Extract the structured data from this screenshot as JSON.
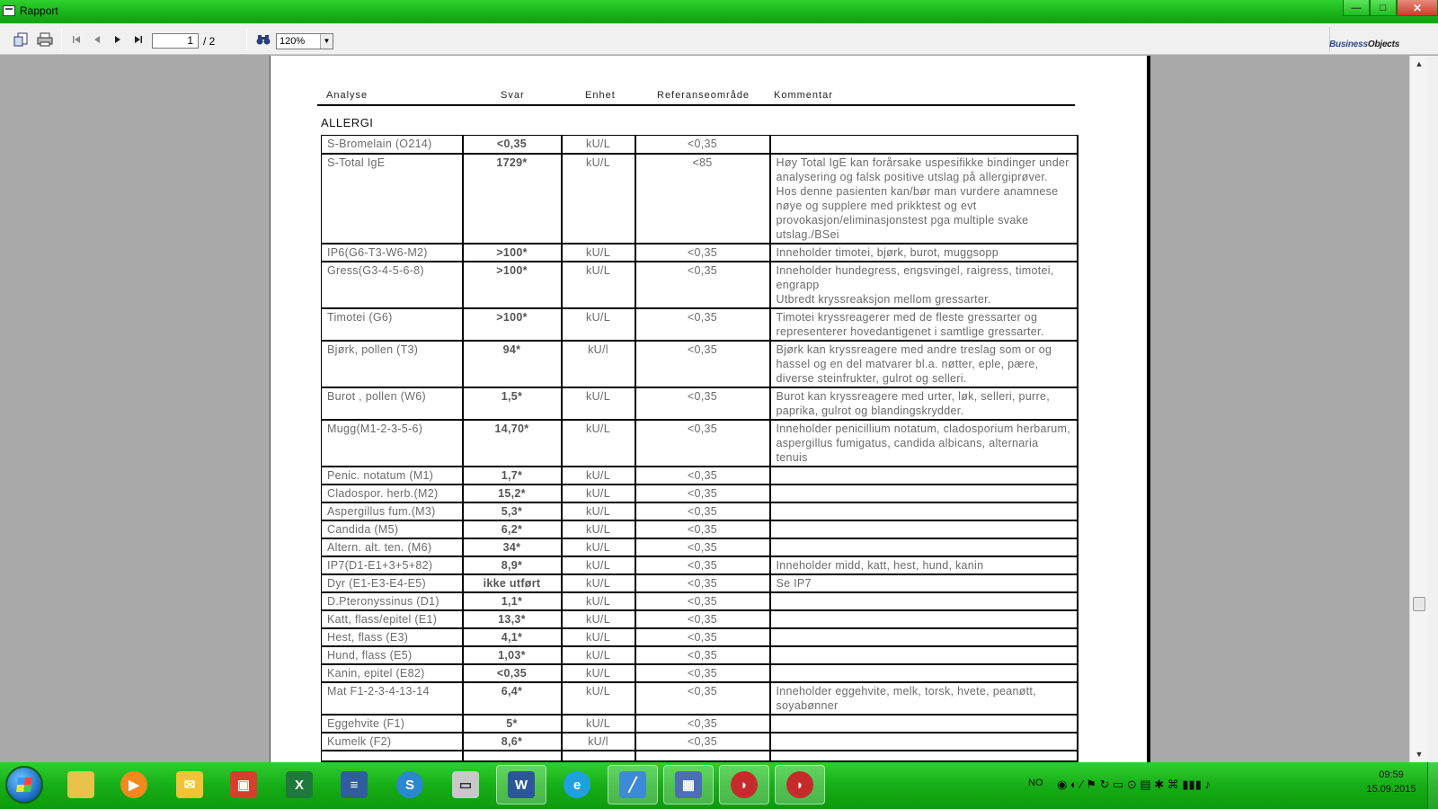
{
  "window": {
    "title": "Rapport",
    "minimize": "—",
    "maximize": "□",
    "close": "✕"
  },
  "toolbar": {
    "page_current": "1",
    "page_total": "/ 2",
    "zoom": "120%",
    "brand_a": "Business",
    "brand_b": "Objects"
  },
  "report": {
    "headers": {
      "analyse": "Analyse",
      "svar": "Svar",
      "enhet": "Enhet",
      "ref": "Referanseområde",
      "kommentar": "Kommentar"
    },
    "section": "ALLERGI",
    "rows": [
      {
        "analyse": "S-Bromelain (O214)",
        "svar": "<0,35",
        "enhet": "kU/L",
        "ref": "<0,35",
        "kommentar": ""
      },
      {
        "analyse": "S-Total IgE",
        "svar": "1729*",
        "enhet": "kU/L",
        "ref": "<85",
        "kommentar": "Høy Total IgE kan forårsake uspesifikke bindinger under analysering og falsk positive utslag på allergiprøver. Hos denne pasienten kan/bør man vurdere anamnese nøye og supplere med prikktest og evt provokasjon/eliminasjonstest pga multiple svake utslag./BSei"
      },
      {
        "analyse": "IP6(G6-T3-W6-M2)",
        "svar": ">100*",
        "enhet": "kU/L",
        "ref": "<0,35",
        "kommentar": "Inneholder timotei, bjørk, burot, muggsopp"
      },
      {
        "analyse": "Gress(G3-4-5-6-8)",
        "svar": ">100*",
        "enhet": "kU/L",
        "ref": "<0,35",
        "kommentar": "Inneholder hundegress, engsvingel, raigress, timotei, engrapp\nUtbredt kryssreaksjon mellom gressarter."
      },
      {
        "analyse": "Timotei (G6)",
        "svar": ">100*",
        "enhet": "kU/L",
        "ref": "<0,35",
        "kommentar": "Timotei kryssreagerer med de fleste gressarter og representerer hovedantigenet i samtlige gressarter."
      },
      {
        "analyse": "Bjørk, pollen (T3)",
        "svar": "94*",
        "enhet": "kU/l",
        "ref": "<0,35",
        "kommentar": "Bjørk kan kryssreagere med andre treslag som or og hassel og en del matvarer bl.a. nøtter, eple, pære, diverse steinfrukter, gulrot og selleri."
      },
      {
        "analyse": "Burot , pollen (W6)",
        "svar": "1,5*",
        "enhet": "kU/L",
        "ref": "<0,35",
        "kommentar": "Burot kan kryssreagere med urter, løk, selleri, purre, paprika, gulrot og blandingskrydder."
      },
      {
        "analyse": "Mugg(M1-2-3-5-6)",
        "svar": "14,70*",
        "enhet": "kU/L",
        "ref": "<0,35",
        "kommentar": "Inneholder penicillium notatum, cladosporium herbarum, aspergillus fumigatus, candida albicans, alternaria tenuis"
      },
      {
        "analyse": "Penic. notatum (M1)",
        "svar": "1,7*",
        "enhet": "kU/L",
        "ref": "<0,35",
        "kommentar": ""
      },
      {
        "analyse": "Cladospor. herb.(M2)",
        "svar": "15,2*",
        "enhet": "kU/L",
        "ref": "<0,35",
        "kommentar": ""
      },
      {
        "analyse": "Aspergillus fum.(M3)",
        "svar": "5,3*",
        "enhet": "kU/L",
        "ref": "<0,35",
        "kommentar": ""
      },
      {
        "analyse": "Candida (M5)",
        "svar": "6,2*",
        "enhet": "kU/L",
        "ref": "<0,35",
        "kommentar": ""
      },
      {
        "analyse": "Altern. alt. ten. (M6)",
        "svar": "34*",
        "enhet": "kU/L",
        "ref": "<0,35",
        "kommentar": ""
      },
      {
        "analyse": "IP7(D1-E1+3+5+82)",
        "svar": "8,9*",
        "enhet": "kU/L",
        "ref": "<0,35",
        "kommentar": "Inneholder midd, katt, hest, hund, kanin"
      },
      {
        "analyse": "Dyr (E1-E3-E4-E5)",
        "svar": "ikke utført",
        "enhet": "kU/L",
        "ref": "<0,35",
        "kommentar": "Se IP7"
      },
      {
        "analyse": "D.Pteronyssinus (D1)",
        "svar": "1,1*",
        "enhet": "kU/L",
        "ref": "<0,35",
        "kommentar": ""
      },
      {
        "analyse": "Katt, flass/epitel (E1)",
        "svar": "13,3*",
        "enhet": "kU/L",
        "ref": "<0,35",
        "kommentar": ""
      },
      {
        "analyse": "Hest, flass (E3)",
        "svar": "4,1*",
        "enhet": "kU/L",
        "ref": "<0,35",
        "kommentar": ""
      },
      {
        "analyse": "Hund, flass (E5)",
        "svar": "1,03*",
        "enhet": "kU/L",
        "ref": "<0,35",
        "kommentar": ""
      },
      {
        "analyse": "Kanin, epitel (E82)",
        "svar": "<0,35",
        "enhet": "kU/L",
        "ref": "<0,35",
        "kommentar": ""
      },
      {
        "analyse": "Mat F1-2-3-4-13-14",
        "svar": "6,4*",
        "enhet": "kU/L",
        "ref": "<0,35",
        "kommentar": "Inneholder eggehvite, melk, torsk, hvete, peanøtt, soyabønner"
      },
      {
        "analyse": "Eggehvite (F1)",
        "svar": "5*",
        "enhet": "kU/L",
        "ref": "<0,35",
        "kommentar": ""
      },
      {
        "analyse": "Kumelk (F2)",
        "svar": "8,6*",
        "enhet": "kU/l",
        "ref": "<0,35",
        "kommentar": ""
      },
      {
        "analyse": "",
        "svar": "",
        "enhet": "",
        "ref": "",
        "kommentar": ""
      }
    ]
  },
  "taskbar": {
    "language": "NO",
    "time": "09:59",
    "date": "15.09.2015"
  },
  "colors": {
    "taskbar_green": "#19b219",
    "viewer_gray": "#a9a9a9"
  }
}
